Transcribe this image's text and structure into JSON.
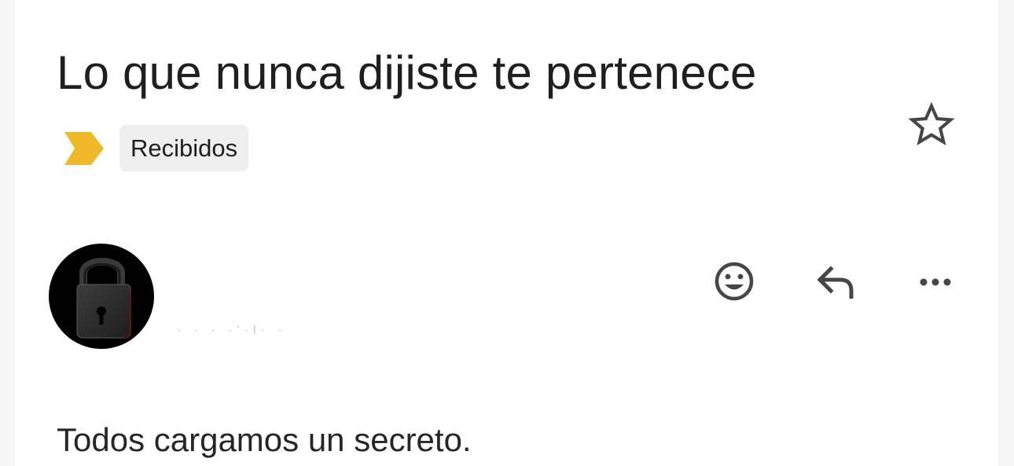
{
  "email": {
    "subject": "Lo que nunca dijiste te pertenece",
    "label": "Recibidos",
    "body_first_line": "Todos cargamos un secreto."
  },
  "icons": {
    "importance": "importance-marker-icon",
    "star": "star-outline-icon",
    "emoji": "emoji-reaction-icon",
    "reply": "reply-arrow-icon",
    "more": "more-horizontal-icon",
    "avatar": "padlock-avatar"
  },
  "colors": {
    "importance": "#f0b92b",
    "chip_background": "#efefef",
    "icon_gray": "#444746"
  }
}
